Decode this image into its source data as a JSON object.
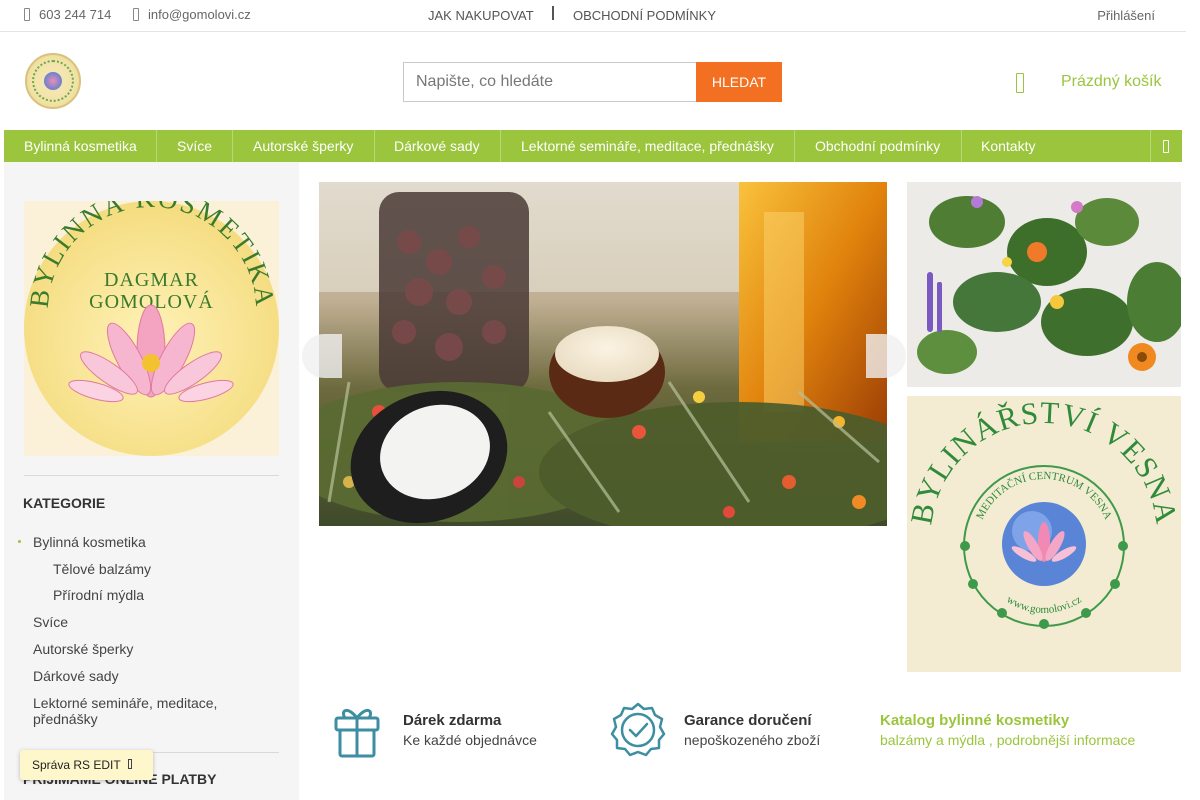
{
  "topbar": {
    "phone": "603 244 714",
    "email": "info@gomolovi.cz",
    "links": [
      "JAK NAKUPOVAT",
      "OBCHODNÍ PODMÍNKY"
    ],
    "login": "Přihlášení"
  },
  "header": {
    "logo_icon": "lotus-logo-icon",
    "search_placeholder": "Napište, co hledáte",
    "search_button": "HLEDAT",
    "cart_icon": "cart-icon",
    "cart_label": "Prázdný košík"
  },
  "menu": {
    "items": [
      "Bylinná kosmetika",
      "Svíce",
      "Autorské šperky",
      "Dárkové sady",
      "Lektorné semináře, meditace, přednášky",
      "Obchodní podmínky",
      "Kontakty"
    ],
    "more_icon": "menu-more-icon"
  },
  "sidebar": {
    "banner_text": {
      "arc": "BYLINNÁ KOSMETIKA",
      "line1": "DAGMAR",
      "line2": "GOMOLOVÁ"
    },
    "category_heading": "KATEGORIE",
    "categories": [
      {
        "label": "Bylinná kosmetika"
      },
      {
        "label": "Tělové balzámy"
      },
      {
        "label": "Přírodní mýdla"
      },
      {
        "label": "Svíce"
      },
      {
        "label": "Autorské šperky"
      },
      {
        "label": "Dárkové sady"
      },
      {
        "label": "Lektorné semináře, meditace, přednášky"
      }
    ],
    "payments_heading": "PŘIJÍMÁME ONLINE PLATBY"
  },
  "banners": {
    "vesna_arc": "BYLINÁŘSTVÍ VESNA",
    "vesna_inner": "MEDITAČNÍ CENTRUM VESNA",
    "vesna_url": "www.gomolovi.cz"
  },
  "benefits": [
    {
      "icon": "gift-icon",
      "title": "Dárek zdarma",
      "subtitle": "Ke každé objednávce"
    },
    {
      "icon": "badge-check-icon",
      "title": "Garance doručení",
      "subtitle": "nepoškozeného zboží"
    },
    {
      "title": "Katalog bylinné kosmetiky",
      "subtitle": "balzámy a mýdla , podrobnější informace"
    }
  ],
  "admin": {
    "label": "Správa RS EDIT"
  },
  "colors": {
    "accent_green": "#9bc53d",
    "search_orange": "#f36f21",
    "gift_teal": "#3c8ea0"
  }
}
